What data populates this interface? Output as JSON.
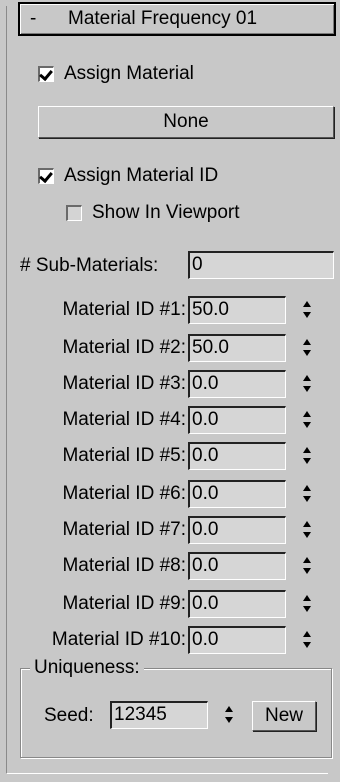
{
  "rollout": {
    "toggle": "-",
    "title": "Material Frequency 01"
  },
  "assign_material": {
    "label": "Assign Material",
    "checked": true,
    "button_label": "None"
  },
  "assign_material_id": {
    "label": "Assign Material ID",
    "checked": true
  },
  "show_in_viewport": {
    "label": "Show In Viewport",
    "checked": false
  },
  "sub_materials": {
    "label": "# Sub-Materials:",
    "value": "0"
  },
  "material_ids": [
    {
      "label": "Material ID #1:",
      "value": "50.0"
    },
    {
      "label": "Material ID #2:",
      "value": "50.0"
    },
    {
      "label": "Material ID #3:",
      "value": "0.0"
    },
    {
      "label": "Material ID #4:",
      "value": "0.0"
    },
    {
      "label": "Material ID #5:",
      "value": "0.0"
    },
    {
      "label": "Material ID #6:",
      "value": "0.0"
    },
    {
      "label": "Material ID #7:",
      "value": "0.0"
    },
    {
      "label": "Material ID #8:",
      "value": "0.0"
    },
    {
      "label": "Material ID #9:",
      "value": "0.0"
    },
    {
      "label": "Material ID #10:",
      "value": "0.0"
    }
  ],
  "uniqueness": {
    "group_label": "Uniqueness:",
    "seed_label": "Seed:",
    "seed_value": "12345",
    "new_button": "New"
  }
}
